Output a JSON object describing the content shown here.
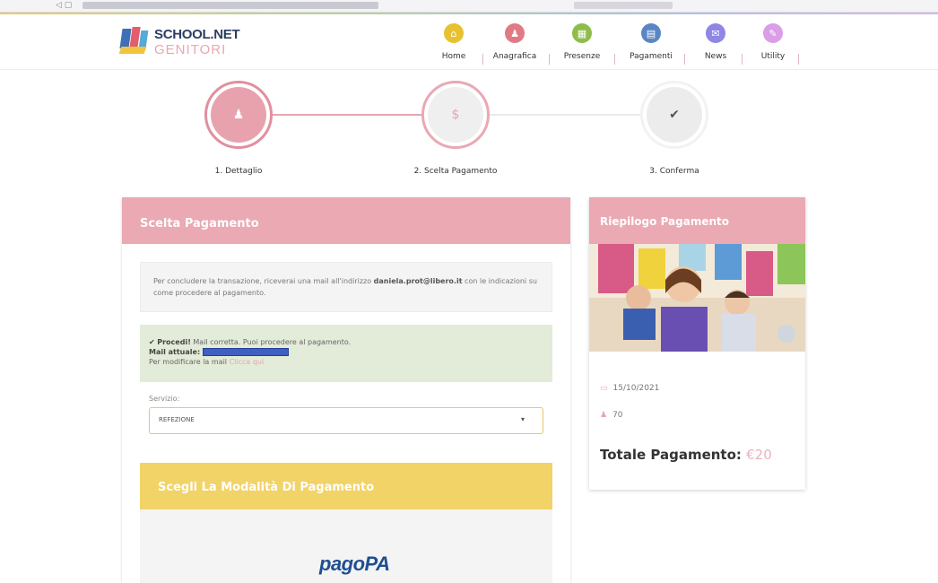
{
  "header": {
    "logo_line1": "SCHOOL.NET",
    "logo_line2": "GENITORI",
    "nav": [
      {
        "label": "Home",
        "icon": "home-icon",
        "color": "#e8c12e",
        "glyph": "⌂"
      },
      {
        "label": "Anagrafica",
        "icon": "person-icon",
        "color": "#e27a86",
        "glyph": "♟"
      },
      {
        "label": "Presenze",
        "icon": "calendar-icon",
        "color": "#8ebd4c",
        "glyph": "▦"
      },
      {
        "label": "Pagamenti",
        "icon": "wallet-icon",
        "color": "#5b86c4",
        "glyph": "▤"
      },
      {
        "label": "News",
        "icon": "news-icon",
        "color": "#8f86e6",
        "glyph": "✉"
      },
      {
        "label": "Utility",
        "icon": "utility-icon",
        "color": "#d99ee6",
        "glyph": "✎"
      }
    ]
  },
  "stepper": {
    "steps": [
      {
        "label": "1. Dettaglio",
        "glyph": "♟",
        "icon": "person-icon"
      },
      {
        "label": "2. Scelta Pagamento",
        "glyph": "$",
        "icon": "dollar-icon"
      },
      {
        "label": "3. Conferma",
        "glyph": "✔",
        "icon": "check-icon"
      }
    ]
  },
  "main": {
    "title": "Scelta Pagamento",
    "info_text_pre": "Per concludere la transazione, riceverai una mail all'indirizzo ",
    "info_email": "daniela.prot@libero.it",
    "info_text_post": " con le indicazioni su come procedere al pagamento.",
    "success_check": "✔",
    "success_bold": "Procedi!",
    "success_text": " Mail corretta. Puoi procedere al pagamento.",
    "mail_label": "Mail attuale:",
    "modify_text": "Per modificare la mail ",
    "modify_link": "Clicca qui",
    "servizio_label": "Servizio:",
    "servizio_value": "REFEZIONE",
    "modalita_title": "Scegli La Modalità Di Pagamento",
    "pagopa_logo": "pagoPA"
  },
  "summary": {
    "title": "Riepilogo Pagamento",
    "date": "15/10/2021",
    "user": "70",
    "total_label": "Totale Pagamento:",
    "total_amount": "€20"
  },
  "colors": {
    "accent_pink": "#eaa9b3",
    "accent_yellow": "#f2d367",
    "success_bg": "#e3ebd9"
  }
}
